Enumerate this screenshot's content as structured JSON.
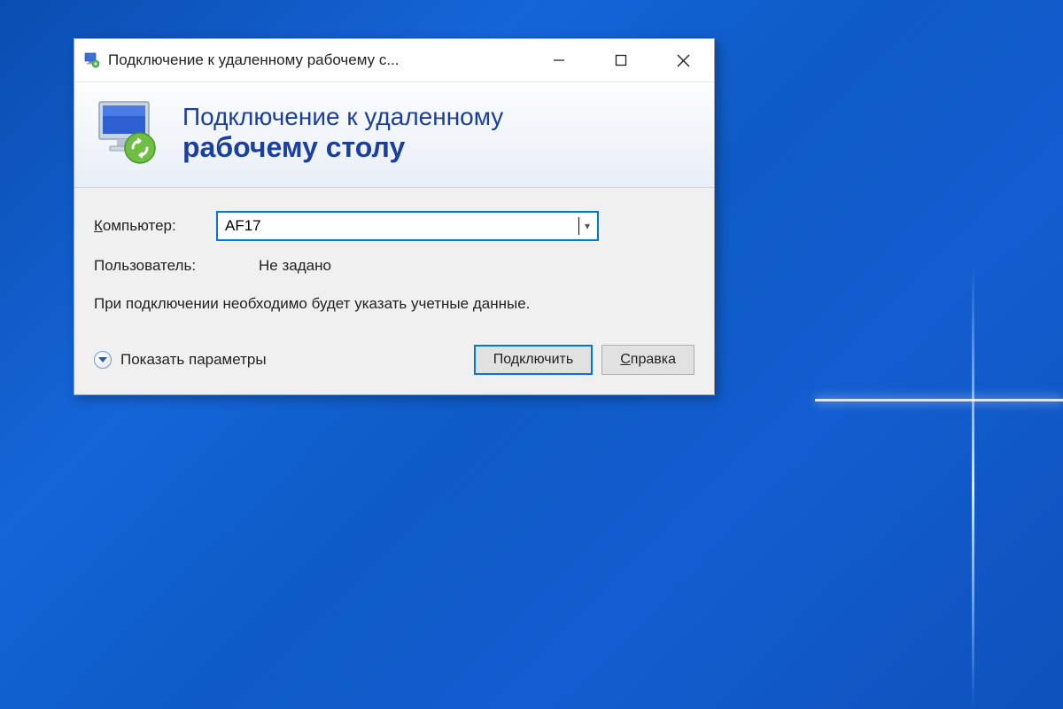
{
  "window": {
    "title": "Подключение к удаленному рабочему с..."
  },
  "header": {
    "line1": "Подключение к удаленному",
    "line2": "рабочему столу"
  },
  "form": {
    "computer_label_prefix": "К",
    "computer_label_rest": "омпьютер:",
    "computer_value": "AF17",
    "user_label": "Пользователь:",
    "user_value": "Не задано",
    "info": "При подключении необходимо будет указать учетные данные."
  },
  "footer": {
    "show_options_ul": "П",
    "show_options_rest": "оказать параметры",
    "connect_label": "Подключить",
    "help_ul": "С",
    "help_rest": "правка"
  }
}
